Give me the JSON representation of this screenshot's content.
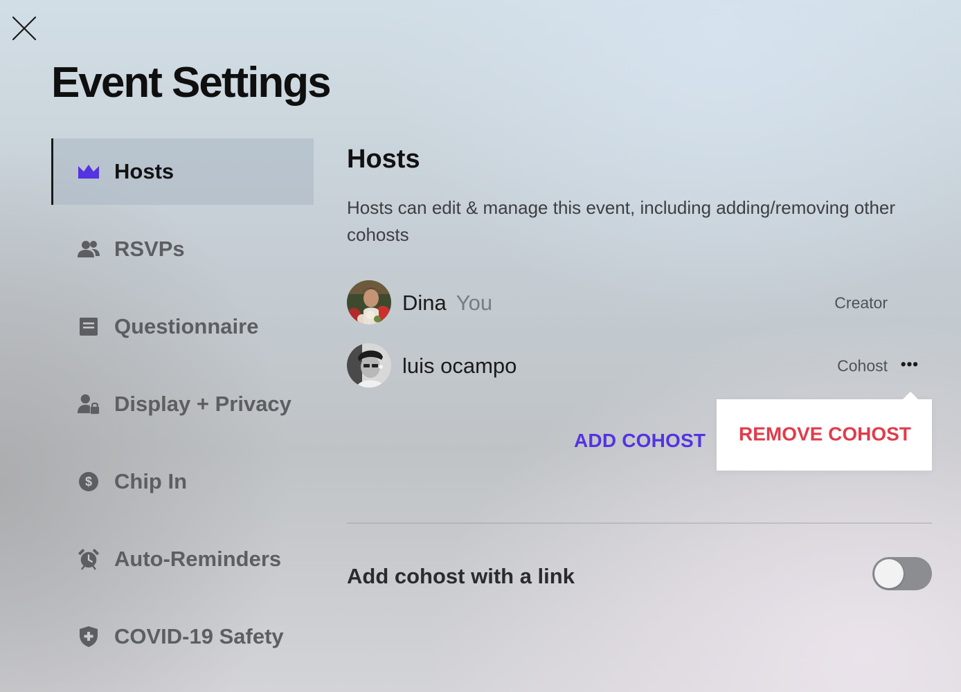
{
  "page": {
    "title": "Event Settings"
  },
  "sidebar": {
    "items": [
      {
        "label": "Hosts",
        "icon": "crown-icon",
        "active": true
      },
      {
        "label": "RSVPs",
        "icon": "people-icon",
        "active": false
      },
      {
        "label": "Questionnaire",
        "icon": "document-icon",
        "active": false
      },
      {
        "label": "Display + Privacy",
        "icon": "user-lock-icon",
        "active": false
      },
      {
        "label": "Chip In",
        "icon": "dollar-coin-icon",
        "active": false
      },
      {
        "label": "Auto-Reminders",
        "icon": "alarm-clock-icon",
        "active": false
      },
      {
        "label": "COVID-19 Safety",
        "icon": "shield-plus-icon",
        "active": false
      }
    ]
  },
  "hosts": {
    "title": "Hosts",
    "description": "Hosts can edit & manage this event, including adding/removing other cohosts",
    "list": [
      {
        "name": "Dina",
        "tag": "You",
        "role": "Creator"
      },
      {
        "name": "luis ocampo",
        "tag": "",
        "role": "Cohost"
      }
    ],
    "add_cohost_label": "ADD COHOST",
    "menu": {
      "remove_label": "REMOVE COHOST"
    },
    "link_toggle": {
      "label": "Add cohost with a link",
      "enabled": false
    }
  },
  "colors": {
    "accent": "#5433e0",
    "danger": "#e03c4b",
    "toggle_off": "#8c8d91",
    "icon_gray": "#5d5e62"
  }
}
